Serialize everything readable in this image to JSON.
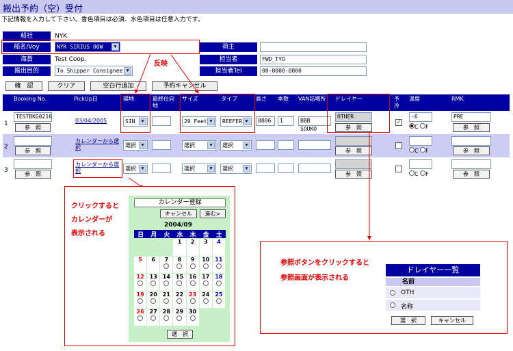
{
  "title": "搬出予約（空）受付",
  "instruction": "下記情報を入力して下さい。香色項目は必須、水色項目は任意入力です。",
  "header": {
    "carrier_label": "船社",
    "carrier_value": "NYK",
    "vessel_label": "船名/Voy",
    "vessel_value": "NYK SIRIUS 00W",
    "cargo_label": "海貨",
    "cargo_value": "Test Coop.",
    "purpose_label": "搬出目的",
    "purpose_value": "To Shipper Consignee",
    "shipper_label": "荷主",
    "shipper_value": "",
    "person_label": "担当者",
    "person_value": "FWD_TYO",
    "tel_label": "担当者Tel",
    "tel_value": "00-0000-0000"
  },
  "annotation_reflect": "反映",
  "buttons": {
    "confirm": "確　認",
    "clear": "クリア",
    "add_row": "空白行追加",
    "cancel_reservation": "予約キャンセル"
  },
  "table": {
    "headers": [
      "Booking No.",
      "PickUp日",
      "揚地",
      "最終仕向地",
      "サイズ",
      "タイプ",
      "高さ",
      "本数",
      "VAN詰場所",
      "ドレイヤー",
      "予冷",
      "温度",
      "RMK"
    ],
    "ref_label": "参　照",
    "select_label": "選択",
    "calendar_select": "カレンダーから選択",
    "radio_c": "C",
    "radio_f": "F",
    "rows": [
      {
        "no": "1",
        "booking": "TESTBKG0216",
        "pickup": "03/04/2005",
        "port": "SIN",
        "dest": "",
        "size": "20 Feet",
        "type": "REEFER",
        "height": "0806",
        "count": "1",
        "van": "BBB SOUKO",
        "drayage": "OTHER",
        "temp": "-6",
        "rmk": "PRE"
      },
      {
        "no": "2",
        "booking": "",
        "pickup": "",
        "port": "",
        "dest": "",
        "size": "",
        "type": "",
        "height": "",
        "count": "",
        "van": "",
        "drayage": "",
        "temp": "",
        "rmk": ""
      },
      {
        "no": "3",
        "booking": "",
        "pickup": "",
        "port": "",
        "dest": "",
        "size": "",
        "type": "",
        "height": "",
        "count": "",
        "van": "",
        "drayage": "",
        "temp": "",
        "rmk": ""
      }
    ]
  },
  "calendar_note": [
    "クリックすると",
    "カレンダーが",
    "表示される"
  ],
  "calendar": {
    "title": "カレンダー登録",
    "cancel": "キャンセル",
    "next": "進む>",
    "month": "2004/09",
    "weekdays": [
      "日",
      "月",
      "火",
      "水",
      "木",
      "金",
      "土"
    ],
    "select": "選　択"
  },
  "ref_note": [
    "参照ボタンをクリックすると",
    "参照画面が表示される"
  ],
  "drayage_list": {
    "title": "ドレイヤー一覧",
    "col_name": "名前",
    "opt1": "OTH",
    "opt2": "名称",
    "select": "選　択",
    "cancel": "キャンセル"
  }
}
